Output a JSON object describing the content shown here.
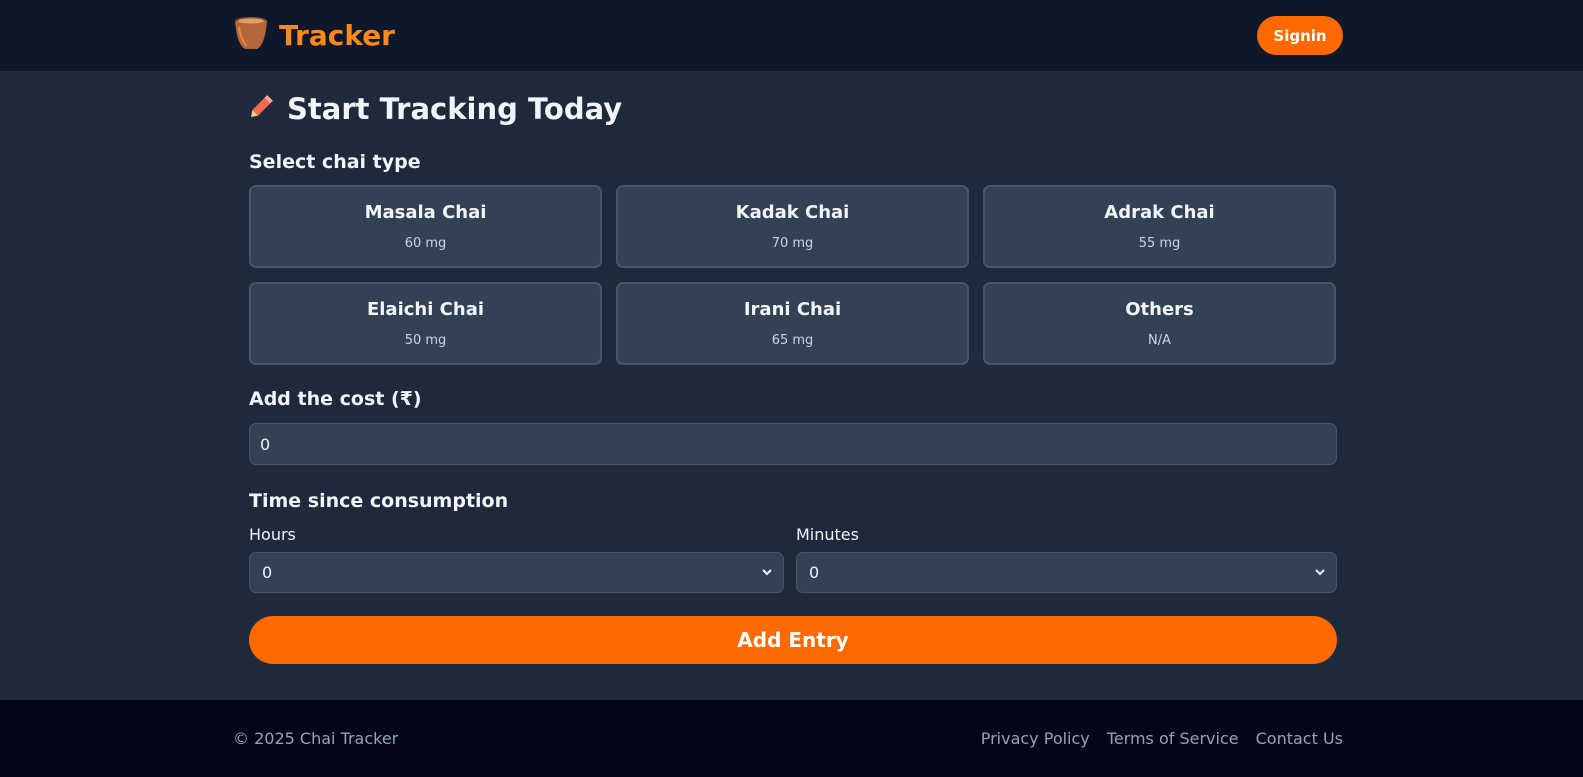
{
  "header": {
    "brand_title": "Tracker",
    "signin_label": "Signin"
  },
  "main": {
    "page_title": "Start Tracking Today",
    "chai_section_label": "Select chai type",
    "chai_types": [
      {
        "name": "Masala Chai",
        "caffeine": "60 mg"
      },
      {
        "name": "Kadak Chai",
        "caffeine": "70 mg"
      },
      {
        "name": "Adrak Chai",
        "caffeine": "55 mg"
      },
      {
        "name": "Elaichi Chai",
        "caffeine": "50 mg"
      },
      {
        "name": "Irani Chai",
        "caffeine": "65 mg"
      },
      {
        "name": "Others",
        "caffeine": "N/A"
      }
    ],
    "cost_label": "Add the cost (₹)",
    "cost_value": "0",
    "time_label": "Time since consumption",
    "hours_label": "Hours",
    "hours_value": "0",
    "minutes_label": "Minutes",
    "minutes_value": "0",
    "add_entry_label": "Add Entry"
  },
  "footer": {
    "copyright": "© 2025 Chai Tracker",
    "links": [
      "Privacy Policy",
      "Terms of Service",
      "Contact Us"
    ]
  },
  "colors": {
    "accent": "#ff6a00",
    "brand": "#fb8a1c",
    "header_bg": "#0f172a",
    "page_bg": "#1e293b",
    "card_bg": "#334155",
    "footer_bg": "#020617"
  },
  "icons": {
    "brand": "chai-cup-icon",
    "title": "pencil-icon",
    "select": "chevron-down-icon"
  }
}
